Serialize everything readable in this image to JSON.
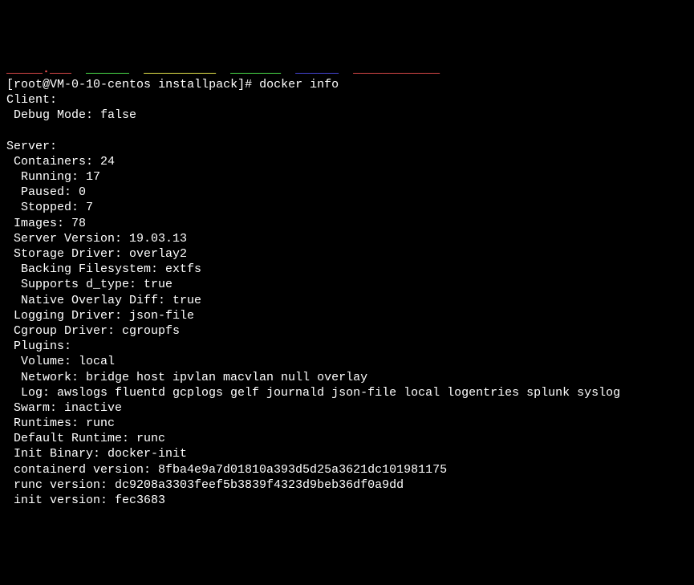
{
  "top_fragments": {
    "f1": "_____.___",
    "f2": "______",
    "f3": "__________",
    "f4": "_______",
    "f5": "______",
    "f6": "____________"
  },
  "prompt": {
    "user_host": "root@VM-0-10-centos",
    "cwd": "installpack",
    "command": "docker info"
  },
  "lines": [
    "Client:",
    " Debug Mode: false",
    "",
    "Server:",
    " Containers: 24",
    "  Running: 17",
    "  Paused: 0",
    "  Stopped: 7",
    " Images: 78",
    " Server Version: 19.03.13",
    " Storage Driver: overlay2",
    "  Backing Filesystem: extfs",
    "  Supports d_type: true",
    "  Native Overlay Diff: true",
    " Logging Driver: json-file",
    " Cgroup Driver: cgroupfs",
    " Plugins:",
    "  Volume: local",
    "  Network: bridge host ipvlan macvlan null overlay",
    "  Log: awslogs fluentd gcplogs gelf journald json-file local logentries splunk syslog",
    " Swarm: inactive",
    " Runtimes: runc",
    " Default Runtime: runc",
    " Init Binary: docker-init",
    " containerd version: 8fba4e9a7d01810a393d5d25a3621dc101981175",
    " runc version: dc9208a3303feef5b3839f4323d9beb36df0a9dd",
    " init version: fec3683"
  ]
}
